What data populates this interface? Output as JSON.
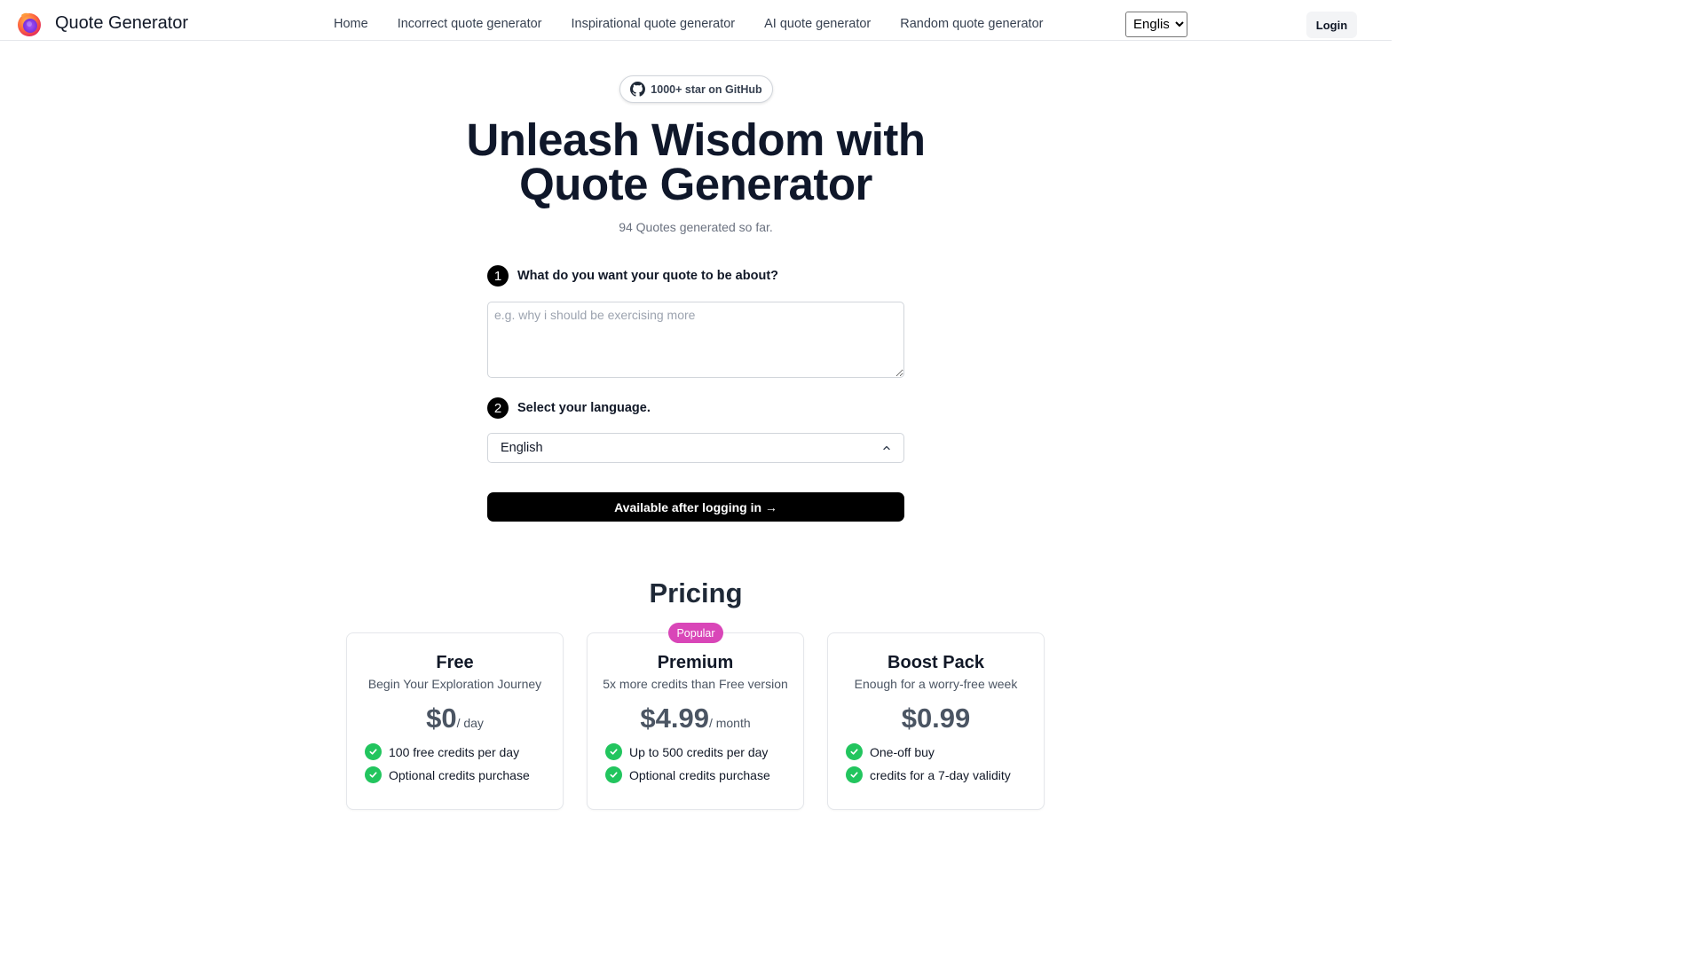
{
  "header": {
    "brand": "Quote Generator",
    "nav": [
      "Home",
      "Incorrect quote generator",
      "Inspirational quote generator",
      "AI quote generator",
      "Random quote generator"
    ],
    "language": "English",
    "login_label": "Login"
  },
  "hero": {
    "github_label": "1000+ star on GitHub",
    "title_line1": "Unleash Wisdom with",
    "title_line2": "Quote Generator",
    "subtitle": "94 Quotes generated so far."
  },
  "form": {
    "step1": {
      "num": "1",
      "label": "What do you want your quote to be about?"
    },
    "textarea_placeholder": "e.g. why i should be exercising more",
    "step2": {
      "num": "2",
      "label": "Select your language."
    },
    "language_value": "English",
    "submit_label": "Available after logging in →"
  },
  "pricing": {
    "title": "Pricing",
    "popular_badge": "Popular",
    "plans": [
      {
        "name": "Free",
        "desc": "Begin Your Exploration Journey",
        "price": "$0",
        "period": "/ day",
        "features": [
          "100 free credits per day",
          "Optional credits purchase"
        ]
      },
      {
        "name": "Premium",
        "desc": "5x more credits than Free version",
        "price": "$4.99",
        "period": "/ month",
        "features": [
          "Up to 500 credits per day",
          "Optional credits purchase"
        ]
      },
      {
        "name": "Boost Pack",
        "desc": "Enough for a worry-free week",
        "price": "$0.99",
        "period": "",
        "features": [
          "One-off buy",
          "credits for a 7-day validity"
        ]
      }
    ]
  },
  "colors": {
    "accent": "#000000",
    "check": "#22c55e",
    "popular": "#d946b8",
    "title": "#0f172a"
  }
}
